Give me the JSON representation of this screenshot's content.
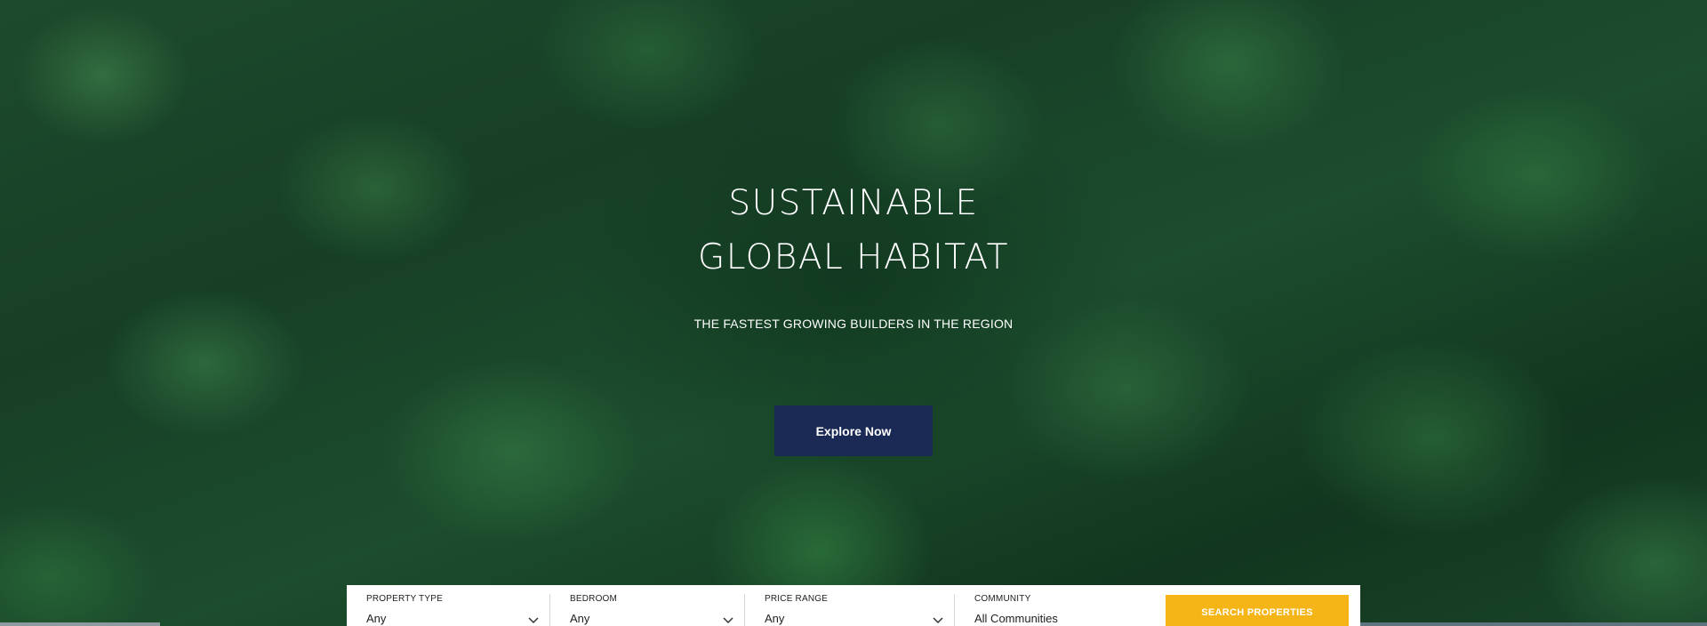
{
  "hero": {
    "headline_line1": "SUSTAINABLE",
    "headline_line2": "GLOBAL HABITAT",
    "subheadline": "THE FASTEST GROWING BUILDERS IN THE REGION",
    "cta_label": "Explore Now",
    "cta_color": "#1b2a55",
    "background": "aerial view of dense green forest canopy"
  },
  "search": {
    "fields": [
      {
        "label": "PROPERTY TYPE",
        "value": "Any",
        "icon": "chevron-down-icon"
      },
      {
        "label": "BEDROOM",
        "value": "Any",
        "icon": "chevron-down-icon"
      },
      {
        "label": "PRICE RANGE",
        "value": "Any",
        "icon": "chevron-down-icon"
      },
      {
        "label": "COMMUNITY",
        "value": "All Communities"
      }
    ],
    "button_label": "SEARCH PROPERTIES",
    "button_color": "#f6b517"
  }
}
